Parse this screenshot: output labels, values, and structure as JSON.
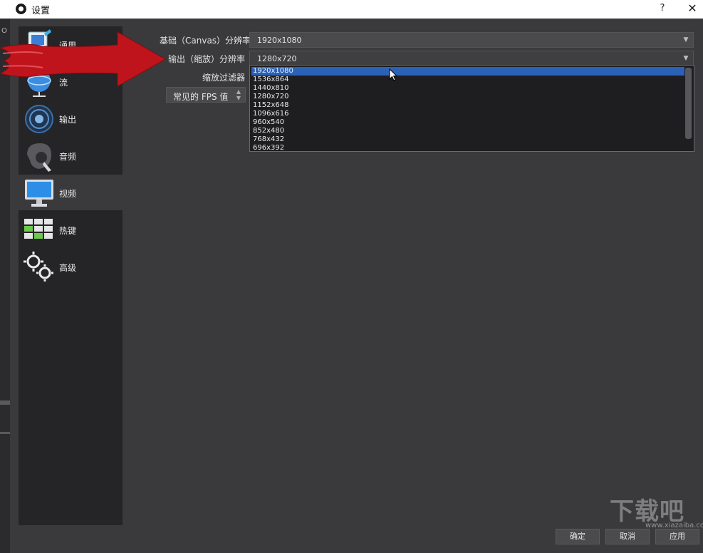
{
  "window": {
    "title": "设置",
    "help": "?",
    "close": "✕"
  },
  "background_fragments": [
    "OB",
    "O"
  ],
  "sidebar": {
    "items": [
      {
        "label": "通用",
        "icon": "general-icon"
      },
      {
        "label": "流",
        "icon": "stream-icon"
      },
      {
        "label": "输出",
        "icon": "output-icon"
      },
      {
        "label": "音频",
        "icon": "audio-icon"
      },
      {
        "label": "视频",
        "icon": "video-icon",
        "active": true
      },
      {
        "label": "热键",
        "icon": "hotkeys-icon"
      },
      {
        "label": "高级",
        "icon": "advanced-icon"
      }
    ]
  },
  "video": {
    "base_label": "基础（Canvas）分辨率",
    "base_value": "1920x1080",
    "output_label": "输出（缩放）分辨率",
    "output_value": "1280x720",
    "filter_label": "缩放过滤器",
    "fps_label": "常见的 FPS 值",
    "dropdown_options": [
      "1920x1080",
      "1536x864",
      "1440x810",
      "1280x720",
      "1152x648",
      "1096x616",
      "960x540",
      "852x480",
      "768x432",
      "696x392"
    ],
    "selected_option": "1920x1080"
  },
  "buttons": {
    "ok": "确定",
    "cancel": "取消",
    "apply": "应用"
  },
  "watermark": {
    "text": "下载吧",
    "url": "www.xiazaiba.com"
  },
  "colors": {
    "accent": "#2a62b8",
    "arrow": "#c0141c",
    "panel": "#3a393c",
    "sidebar": "#252427"
  }
}
